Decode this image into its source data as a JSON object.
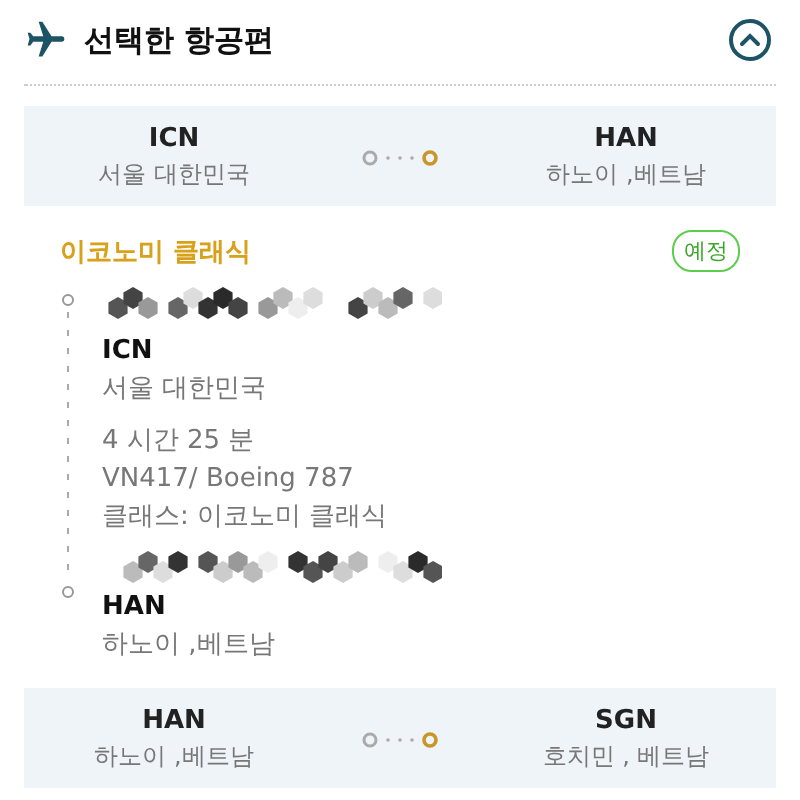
{
  "header": {
    "title": "선택한 항공편",
    "expanded": true
  },
  "sections": [
    {
      "kind": "route",
      "origin": {
        "code": "ICN",
        "city": "서울 대한민국"
      },
      "destination": {
        "code": "HAN",
        "city": "하노이 ,베트남"
      }
    },
    {
      "kind": "detail",
      "cabin": "이코노미 클래식",
      "status": "예정",
      "departure": {
        "code": "ICN",
        "city": "서울 대한민국"
      },
      "duration": "4 시간 25 분",
      "flight": "VN417/ Boeing 787",
      "class_line": "클래스: 이코노미 클래식",
      "arrival": {
        "code": "HAN",
        "city": "하노이 ,베트남"
      }
    },
    {
      "kind": "route",
      "origin": {
        "code": "HAN",
        "city": "하노이 ,베트남"
      },
      "destination": {
        "code": "SGN",
        "city": "호치민 , 베트남"
      }
    }
  ]
}
